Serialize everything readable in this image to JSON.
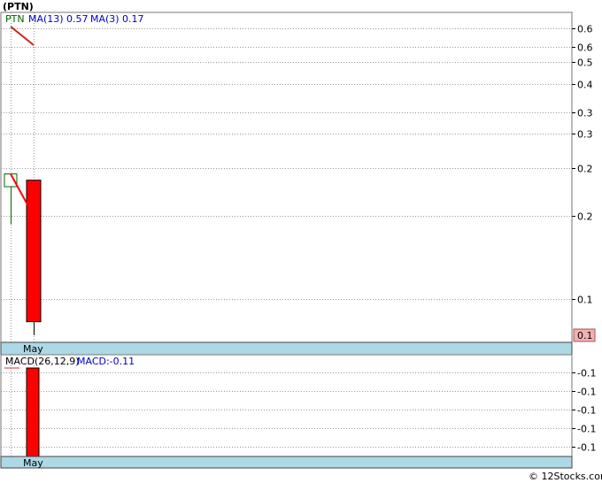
{
  "chart_data": [
    {
      "type": "candlestick",
      "title": "(PTN)",
      "symbol": "PTN",
      "y_scale": "log",
      "ylim": [
        0.083,
        0.72
      ],
      "y_ticks": [
        {
          "value": 0.65,
          "label": "0.6"
        },
        {
          "value": 0.575,
          "label": "0.6"
        },
        {
          "value": 0.52,
          "label": "0.5"
        },
        {
          "value": 0.45,
          "label": "0.4"
        },
        {
          "value": 0.375,
          "label": "0.3"
        },
        {
          "value": 0.325,
          "label": "0.3"
        },
        {
          "value": 0.26,
          "label": "0.2"
        },
        {
          "value": 0.19,
          "label": "0.2"
        },
        {
          "value": 0.11,
          "label": "0.1"
        }
      ],
      "last_price_label": "0.1",
      "x_label": "May",
      "candles": [
        {
          "open": 0.25,
          "close": 0.23,
          "high": 0.25,
          "low": 0.18,
          "color": "#ffffff",
          "border": "#006600"
        },
        {
          "open": 0.24,
          "close": 0.095,
          "high": 0.24,
          "low": 0.087,
          "color": "#ff0000",
          "border": "#000000"
        }
      ],
      "series": [
        {
          "name": "MA(3)",
          "color": "#ff0000",
          "values": [
            0.25,
            0.19
          ]
        }
      ],
      "legend": [
        {
          "text": "PTN",
          "color": "#006600"
        },
        {
          "text": "MA(13)",
          "color": "#0000cc"
        },
        {
          "text": "0.57",
          "color": "#0000cc"
        },
        {
          "text": "MA(3)",
          "color": "#0000cc"
        },
        {
          "text": "0.17",
          "color": "#0000cc"
        }
      ]
    },
    {
      "type": "bar",
      "title": "MACD(26,12,9)",
      "value_label": "MACD:-0.11",
      "y_ticks": [
        "-0.1",
        "-0.1",
        "-0.1",
        "-0.1",
        "-0.1"
      ],
      "x_label": "May",
      "values": [
        -0.11
      ]
    }
  ],
  "footer": {
    "credit": "© 12Stocks.com"
  }
}
